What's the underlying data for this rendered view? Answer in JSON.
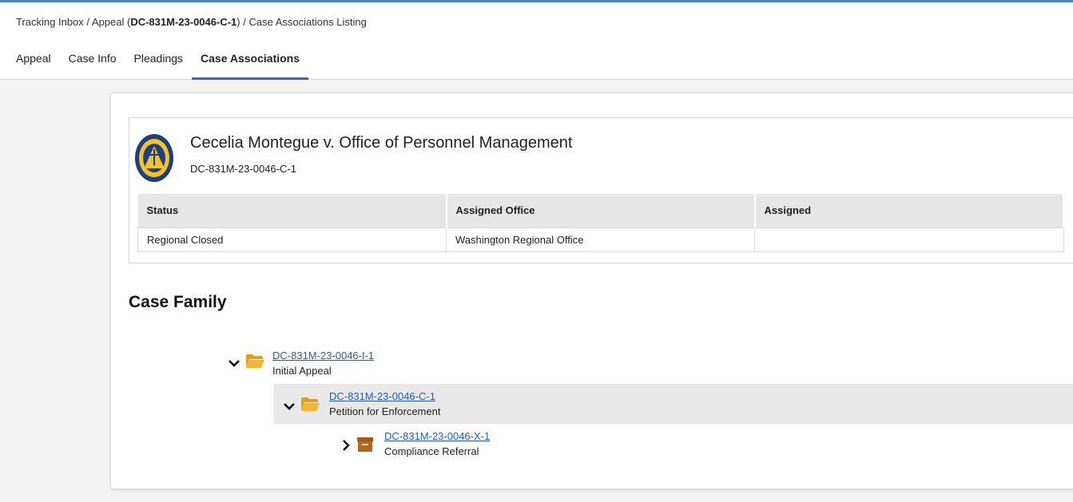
{
  "breadcrumb": {
    "inbox": "Tracking Inbox",
    "sep1": " / ",
    "appeal_prefix": "Appeal (",
    "appeal_id": "DC-831M-23-0046-C-1",
    "appeal_suffix": ")",
    "sep2": " / ",
    "current": "Case Associations Listing"
  },
  "tabs": [
    {
      "label": "Appeal",
      "active": false
    },
    {
      "label": "Case Info",
      "active": false
    },
    {
      "label": "Pleadings",
      "active": false
    },
    {
      "label": "Case Associations",
      "active": true
    }
  ],
  "case": {
    "title": "Cecelia Montegue v. Office of Personnel Management",
    "number": "DC-831M-23-0046-C-1",
    "seal_icon": "mspb-seal-icon"
  },
  "info_table": {
    "headers": [
      "Status",
      "Assigned Office",
      "Assigned"
    ],
    "row": [
      "Regional Closed",
      "Washington Regional Office",
      ""
    ]
  },
  "case_family": {
    "title": "Case Family",
    "nodes": [
      {
        "id": "DC-831M-23-0046-I-1",
        "label": "Initial Appeal",
        "expanded": true,
        "icon": "folder-open-icon"
      },
      {
        "id": "DC-831M-23-0046-C-1",
        "label": "Petition for Enforcement",
        "expanded": true,
        "icon": "folder-open-icon"
      },
      {
        "id": "DC-831M-23-0046-X-1",
        "label": "Compliance Referral",
        "expanded": false,
        "icon": "archive-box-icon"
      }
    ]
  },
  "colors": {
    "accent": "#2f6fb3",
    "link": "#1f5fb8",
    "folder": "#f5b731",
    "archive": "#b5651d"
  }
}
